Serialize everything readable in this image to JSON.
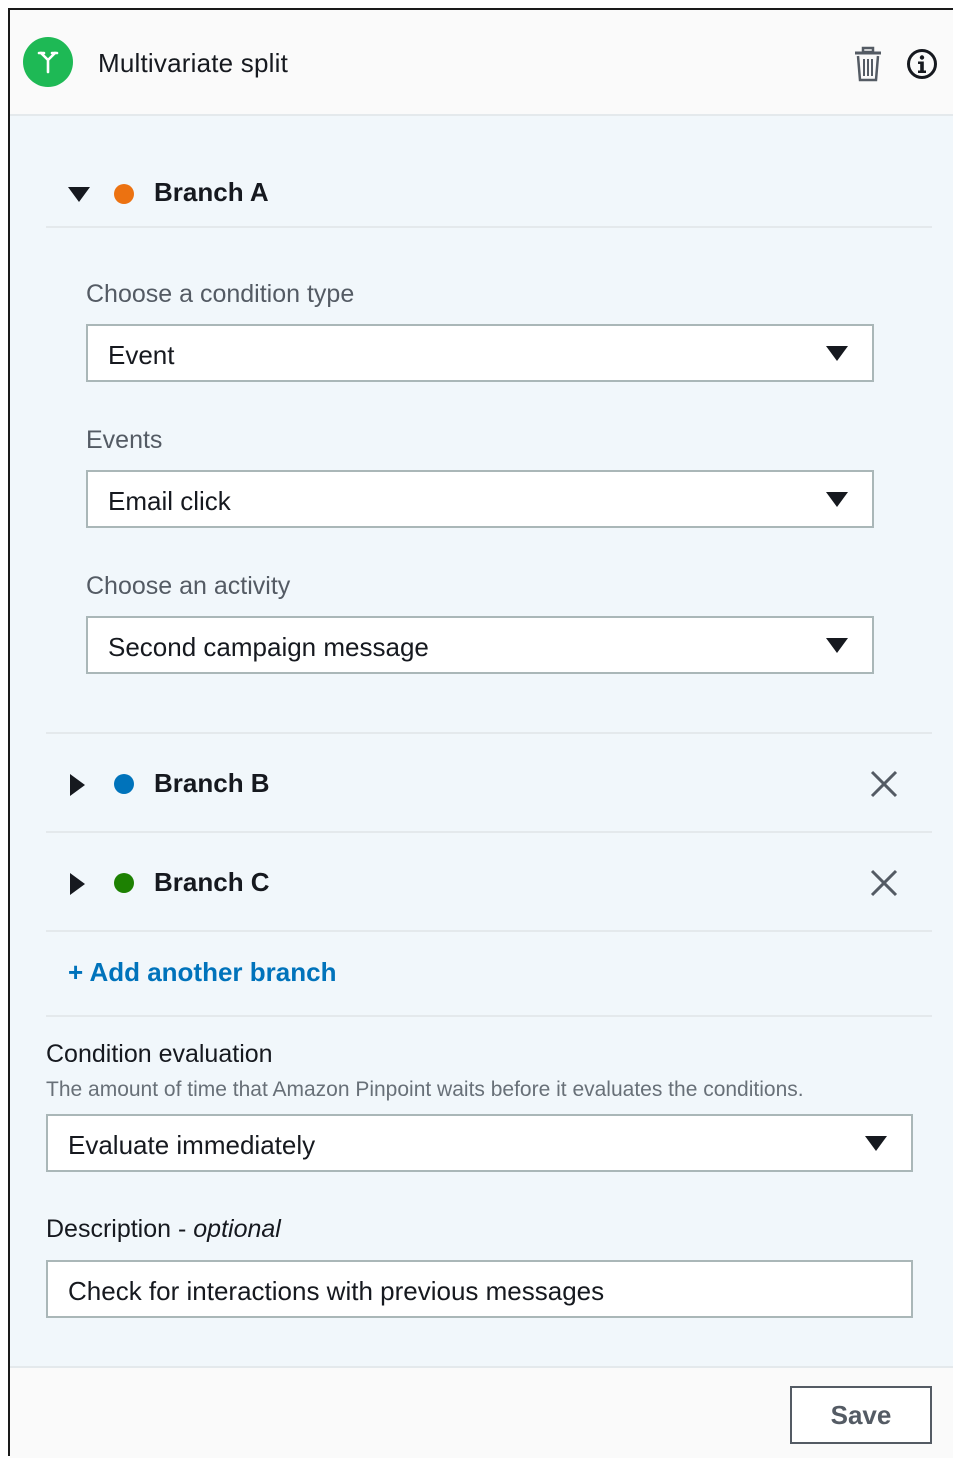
{
  "header": {
    "title": "Multivariate split",
    "icon": "split-icon",
    "accent_color": "#1eb955"
  },
  "branches": [
    {
      "label": "Branch A",
      "color": "#ec7211",
      "expanded": true
    },
    {
      "label": "Branch B",
      "color": "#0073bb",
      "expanded": false
    },
    {
      "label": "Branch C",
      "color": "#1d8102",
      "expanded": false
    }
  ],
  "branch_a": {
    "condition_type_label": "Choose a condition type",
    "condition_type_value": "Event",
    "events_label": "Events",
    "events_value": "Email click",
    "activity_label": "Choose an activity",
    "activity_value": "Second campaign message"
  },
  "add_branch_label": "+ Add another branch",
  "condition_evaluation": {
    "label": "Condition evaluation",
    "hint": "The amount of time that Amazon Pinpoint waits before it evaluates the conditions.",
    "value": "Evaluate immediately"
  },
  "description": {
    "label": "Description - ",
    "label_optional": "optional",
    "value": "Check for interactions with previous messages"
  },
  "footer": {
    "save_label": "Save"
  }
}
